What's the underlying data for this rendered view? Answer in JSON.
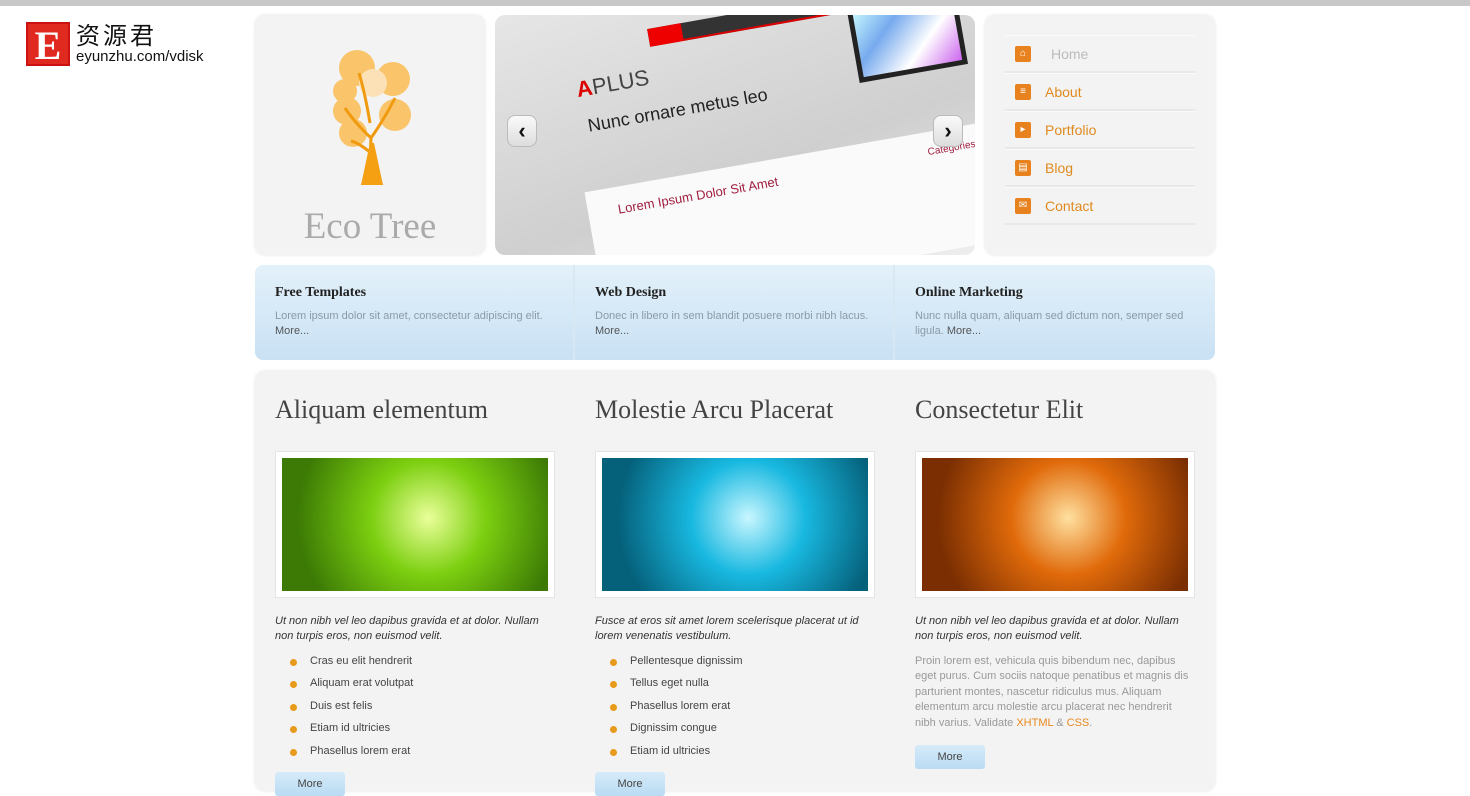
{
  "watermark": {
    "letter": "E",
    "chinese": "资源君",
    "url": "eyunzhu.com/vdisk"
  },
  "brand": {
    "name": "Eco Tree"
  },
  "slider": {
    "image_text": {
      "logo_a": "A",
      "logo_rest": "PLUS",
      "headline": "Nunc ornare metus leo",
      "post_title": "Lorem Ipsum Dolor Sit Amet",
      "categories": "Categories"
    },
    "prev": "‹",
    "next": "›"
  },
  "menu": {
    "items": [
      {
        "label": "Home",
        "icon": "home-icon",
        "active": true
      },
      {
        "label": "About",
        "icon": "about-icon"
      },
      {
        "label": "Portfolio",
        "icon": "portfolio-icon"
      },
      {
        "label": "Blog",
        "icon": "blog-icon"
      },
      {
        "label": "Contact",
        "icon": "contact-icon"
      }
    ]
  },
  "features": [
    {
      "title": "Free Templates",
      "text": "Lorem ipsum dolor sit amet, consectetur adipiscing elit.",
      "more": "More..."
    },
    {
      "title": "Web Design",
      "text": "Donec in libero in sem blandit posuere morbi nibh lacus.",
      "more": "More..."
    },
    {
      "title": "Online Marketing",
      "text": "Nunc nulla quam, aliquam sed dictum non, semper sed ligula.",
      "more": "More..."
    }
  ],
  "columns": [
    {
      "title": "Aliquam elementum",
      "image_color": "#7ccf10",
      "intro": "Ut non nibh vel leo dapibus gravida et at dolor. Nullam non turpis eros, non euismod velit.",
      "list": [
        "Cras eu elit hendrerit",
        "Aliquam erat volutpat",
        "Duis est felis",
        "Etiam id ultricies",
        "Phasellus lorem erat"
      ],
      "more": "More"
    },
    {
      "title": "Molestie Arcu Placerat",
      "image_color": "#18b8e0",
      "intro": "Fusce at eros sit amet lorem scelerisque placerat ut id lorem venenatis vestibulum.",
      "list": [
        "Pellentesque dignissim",
        "Tellus eget nulla",
        "Phasellus lorem erat",
        "Dignissim congue",
        "Etiam id ultricies"
      ],
      "more": "More"
    },
    {
      "title": "Consectetur Elit",
      "image_color": "#e06a0a",
      "intro": "Ut non nibh vel leo dapibus gravida et at dolor. Nullam non turpis eros, non euismod velit.",
      "body": "Proin lorem est, vehicula quis bibendum nec, dapibus eget purus. Cum sociis natoque penatibus et magnis dis parturient montes, nascetur ridiculus mus. Aliquam elementum arcu molestie arcu placerat nec hendrerit nibh varius. Validate ",
      "xhtml": "XHTML",
      "amp": " & ",
      "css": "CSS",
      "period": ".",
      "more": "More"
    }
  ],
  "colors": {
    "accent": "#e8891e",
    "feature_bg": "#d4e9f7",
    "panel": "#f3f3f3"
  }
}
